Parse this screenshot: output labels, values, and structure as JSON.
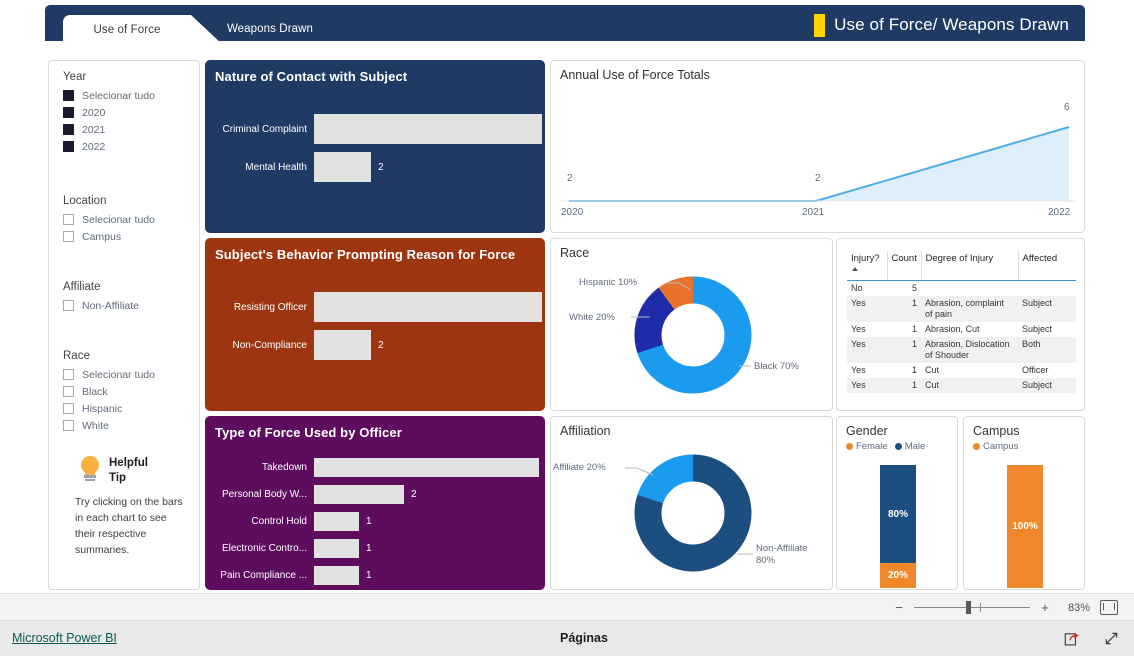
{
  "ribbon": {
    "tabs": [
      {
        "label": "Use of Force",
        "active": true
      },
      {
        "label": "Weapons Drawn",
        "active": false
      }
    ],
    "title": "Use of Force/ Weapons Drawn",
    "accent_color": "#FFD400",
    "bar_color": "#1F3B64"
  },
  "filters": {
    "groups": [
      {
        "heading": "Year",
        "items": [
          {
            "label": "Selecionar tudo",
            "checked": true
          },
          {
            "label": "2020",
            "checked": true
          },
          {
            "label": "2021",
            "checked": true
          },
          {
            "label": "2022",
            "checked": true
          }
        ]
      },
      {
        "heading": "Location",
        "items": [
          {
            "label": "Selecionar tudo",
            "checked": false
          },
          {
            "label": "Campus",
            "checked": false
          }
        ]
      },
      {
        "heading": "Affiliate",
        "items": [
          {
            "label": "Non-Affiliate",
            "checked": false
          }
        ]
      },
      {
        "heading": "Race",
        "items": [
          {
            "label": "Selecionar tudo",
            "checked": false
          },
          {
            "label": "Black",
            "checked": false
          },
          {
            "label": "Hispanic",
            "checked": false
          },
          {
            "label": "White",
            "checked": false
          }
        ]
      }
    ],
    "tip": {
      "title": "Helpful Tip",
      "body": "Try clicking on the bars in each chart to see their respective summaries.",
      "icon": "lightbulb-icon"
    }
  },
  "chart_data": [
    {
      "id": "nature_of_contact",
      "type": "bar",
      "title": "Nature of Contact with Subject",
      "orientation": "horizontal",
      "categories": [
        "Criminal Complaint",
        "Mental Health"
      ],
      "values": [
        8,
        2
      ],
      "xlabel": "",
      "ylabel": "",
      "xlim": [
        0,
        8
      ],
      "grid": false,
      "legend": "none",
      "card_color": "#1F3B64",
      "bar_color": "#E2E2E2"
    },
    {
      "id": "annual_totals",
      "type": "area",
      "title": "Annual Use of Force Totals",
      "x": [
        "2020",
        "2021",
        "2022"
      ],
      "values": [
        2,
        2,
        6
      ],
      "data_labels": [
        "2",
        "2",
        "6"
      ],
      "xlabel": "",
      "ylabel": "",
      "ylim": [
        0,
        6
      ],
      "grid": false,
      "legend": "none",
      "line_color": "#4FAEE8",
      "fill_color": "#DEEEFB"
    },
    {
      "id": "subject_behavior",
      "type": "bar",
      "title": "Subject's Behavior Prompting Reason for Force",
      "orientation": "horizontal",
      "categories": [
        "Resisting Officer",
        "Non-Compliance"
      ],
      "values": [
        8,
        2
      ],
      "xlabel": "",
      "ylabel": "",
      "xlim": [
        0,
        8
      ],
      "grid": false,
      "legend": "none",
      "card_color": "#9E3511",
      "bar_color": "#E2E2E2"
    },
    {
      "id": "race_donut",
      "type": "pie",
      "title": "Race",
      "categories": [
        "Black",
        "White",
        "Hispanic"
      ],
      "values": [
        70,
        20,
        10
      ],
      "labels": [
        "Black 70%",
        "White 20%",
        "Hispanic 10%"
      ],
      "colors": [
        "#1A9BF0",
        "#1F2BA8",
        "#E8722C"
      ],
      "legend": "none",
      "donut": true
    },
    {
      "id": "type_of_force",
      "type": "bar",
      "title": "Type of Force Used by Officer",
      "orientation": "horizontal",
      "categories": [
        "Takedown",
        "Personal Body W...",
        "Control Hold",
        "Electronic Contro...",
        "Pain Compliance ..."
      ],
      "values": [
        5,
        2,
        1,
        1,
        1
      ],
      "xlabel": "",
      "ylabel": "",
      "xlim": [
        0,
        5
      ],
      "grid": false,
      "legend": "none",
      "card_color": "#5E0D5E",
      "bar_color": "#E2E2E2"
    },
    {
      "id": "affiliation_donut",
      "type": "pie",
      "title": "Affiliation",
      "categories": [
        "Non-Affiliate",
        "Affiliate"
      ],
      "values": [
        80,
        20
      ],
      "labels": [
        "Non-Affiliate 80%",
        "Affiliate 20%"
      ],
      "colors": [
        "#1C4E80",
        "#1A9BF0"
      ],
      "legend": "none",
      "donut": true
    },
    {
      "id": "gender_stacked",
      "type": "bar",
      "title": "Gender",
      "orientation": "vertical",
      "stacked": true,
      "categories": [
        "Gender"
      ],
      "series": [
        {
          "name": "Male",
          "values": [
            80
          ],
          "label": "80%",
          "color": "#1C4E80"
        },
        {
          "name": "Female",
          "values": [
            20
          ],
          "label": "20%",
          "color": "#F0882B"
        }
      ],
      "legend": "top",
      "ylim": [
        0,
        100
      ]
    },
    {
      "id": "campus_stacked",
      "type": "bar",
      "title": "Campus",
      "orientation": "vertical",
      "stacked": true,
      "categories": [
        "Campus"
      ],
      "series": [
        {
          "name": "Campus",
          "values": [
            100
          ],
          "label": "100%",
          "color": "#F0882B"
        }
      ],
      "legend": "top",
      "ylim": [
        0,
        100
      ]
    },
    {
      "id": "injury_table",
      "type": "table",
      "title": "",
      "columns": [
        "Injury?",
        "Count",
        "Degree of Injury",
        "Affected"
      ],
      "sorted_column": "Injury?",
      "sort_direction": "asc",
      "rows": [
        [
          "No",
          "5",
          "",
          ""
        ],
        [
          "Yes",
          "1",
          "Abrasion, complaint of pain",
          "Subject"
        ],
        [
          "Yes",
          "1",
          "Abrasion, Cut",
          "Subject"
        ],
        [
          "Yes",
          "1",
          "Abrasion, Dislocation of Shouder",
          "Both"
        ],
        [
          "Yes",
          "1",
          "Cut",
          "Officer"
        ],
        [
          "Yes",
          "1",
          "Cut",
          "Subject"
        ]
      ]
    }
  ],
  "statusbar": {
    "minus": "−",
    "plus": "+",
    "zoom_percent": "83%",
    "fit_icon": "fit-to-page-icon"
  },
  "footer": {
    "brand": "Microsoft Power BI",
    "pages_label": "Páginas",
    "share_icon": "share-icon",
    "fullscreen_icon": "fullscreen-icon"
  }
}
